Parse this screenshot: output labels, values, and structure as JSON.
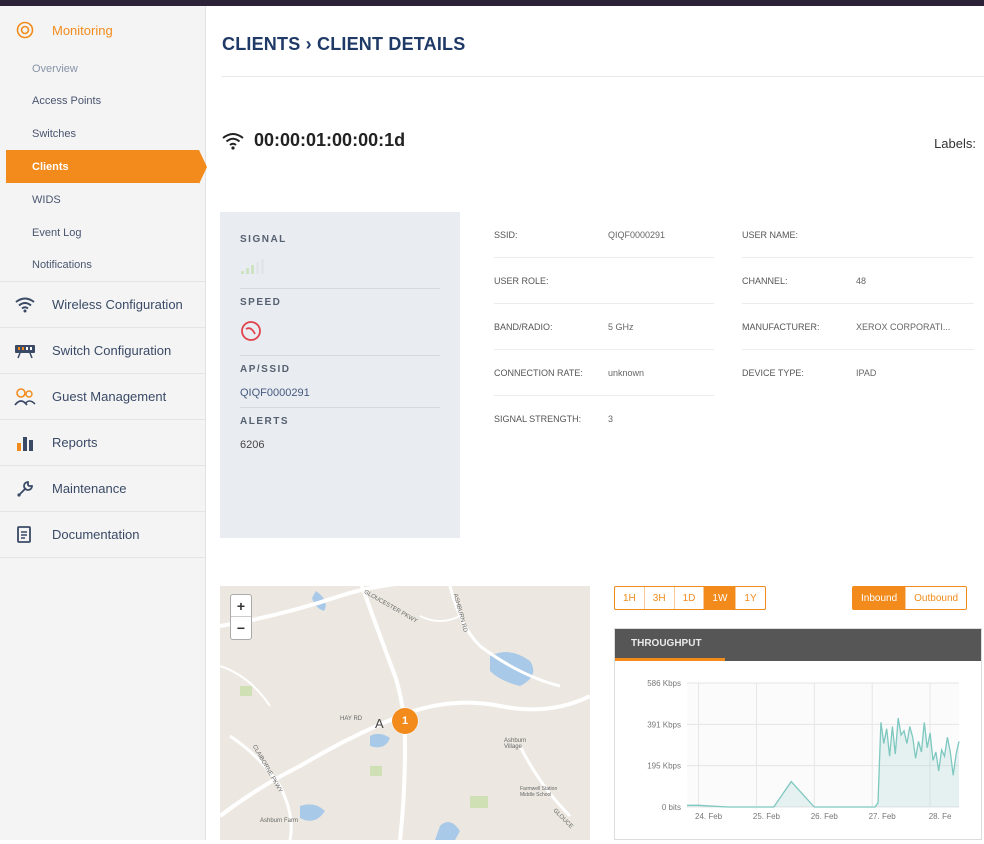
{
  "sidebar": {
    "monitoring": {
      "label": "Monitoring"
    },
    "sub_items": [
      {
        "label": "Overview",
        "active": false
      },
      {
        "label": "Access Points",
        "active": false
      },
      {
        "label": "Switches",
        "active": false
      },
      {
        "label": "Clients",
        "active": true
      },
      {
        "label": "WIDS",
        "active": false
      },
      {
        "label": "Event Log",
        "active": false
      },
      {
        "label": "Notifications",
        "active": false
      }
    ],
    "groups": [
      {
        "label": "Wireless Configuration",
        "icon": "wifi-icon"
      },
      {
        "label": "Switch Configuration",
        "icon": "switch-icon"
      },
      {
        "label": "Guest Management",
        "icon": "guests-icon"
      },
      {
        "label": "Reports",
        "icon": "bar-chart-icon"
      },
      {
        "label": "Maintenance",
        "icon": "wrench-icon"
      },
      {
        "label": "Documentation",
        "icon": "document-icon"
      }
    ]
  },
  "header": {
    "breadcrumb": "CLIENTS › CLIENT DETAILS"
  },
  "client": {
    "mac": "00:00:01:00:00:1d",
    "labels_label": "Labels:"
  },
  "status": {
    "signal_label": "SIGNAL",
    "speed_label": "SPEED",
    "ap_ssid_label": "AP/SSID",
    "ap_ssid_value": "QIQF0000291",
    "alerts_label": "ALERTS",
    "alerts_value": "6206"
  },
  "details": {
    "ssid_label": "SSID:",
    "ssid_value": "QIQF0000291",
    "user_role_label": "USER ROLE:",
    "band_label": "BAND/RADIO:",
    "band_value": "5 GHz",
    "conn_rate_label": "CONNECTION RATE:",
    "conn_rate_value": "unknown",
    "signal_strength_label": "SIGNAL STRENGTH:",
    "signal_strength_value": "3",
    "user_name_label": "USER NAME:",
    "channel_label": "CHANNEL:",
    "channel_value": "48",
    "manufacturer_label": "MANUFACTURER:",
    "manufacturer_value": "XEROX CORPORATI...",
    "device_type_label": "DEVICE TYPE:",
    "device_type_value": "IPAD"
  },
  "map": {
    "zoom_in": "+",
    "zoom_out": "−",
    "cluster_count": "1",
    "road_labels": [
      "GLOUCESTER PKWY",
      "ASHBURN RD",
      "HAY RD",
      "CLAIBORNE PKWY",
      "GLOUCE",
      "Ashburn Farm",
      "Ashburn Village",
      "Farmwell Station Middle School"
    ],
    "place_label": "A      n"
  },
  "time_range": {
    "options": [
      "1H",
      "3H",
      "1D",
      "1W",
      "1Y"
    ],
    "selected": "1W"
  },
  "direction": {
    "options": [
      "Inbound",
      "Outbound"
    ],
    "selected": "Inbound"
  },
  "throughput": {
    "tab_label": "THROUGHPUT"
  },
  "chart_data": {
    "type": "line",
    "title": "",
    "xlabel": "",
    "ylabel": "",
    "y_tick_labels": [
      "586 Kbps",
      "391 Kbps",
      "195 Kbps",
      "0 bits"
    ],
    "x_tick_labels": [
      "24. Feb",
      "25. Feb",
      "26. Feb",
      "27. Feb",
      "28. Fe"
    ],
    "ylim": [
      0,
      586
    ],
    "y_unit": "Kbps",
    "grid": true,
    "series": [
      {
        "color": "#7ec8c0",
        "x": [
          "23.8",
          "24.0",
          "24.5",
          "24.8",
          "25.0",
          "25.3",
          "25.6",
          "26.0",
          "26.5",
          "26.9",
          "27.05",
          "27.1",
          "27.15",
          "27.2",
          "27.25",
          "27.3",
          "27.35",
          "27.4",
          "27.45",
          "27.5",
          "27.55",
          "27.6",
          "27.65",
          "27.7",
          "27.75",
          "27.8",
          "27.85",
          "27.9",
          "27.95",
          "28.0",
          "28.05",
          "28.1",
          "28.15",
          "28.2",
          "28.25",
          "28.3",
          "28.35",
          "28.4",
          "28.45",
          "28.5"
        ],
        "values": [
          8,
          8,
          0,
          0,
          0,
          0,
          120,
          0,
          0,
          0,
          0,
          20,
          400,
          300,
          370,
          240,
          380,
          250,
          420,
          340,
          360,
          300,
          380,
          330,
          230,
          310,
          260,
          400,
          280,
          350,
          220,
          260,
          170,
          270,
          240,
          330,
          260,
          150,
          250,
          310
        ]
      }
    ]
  }
}
